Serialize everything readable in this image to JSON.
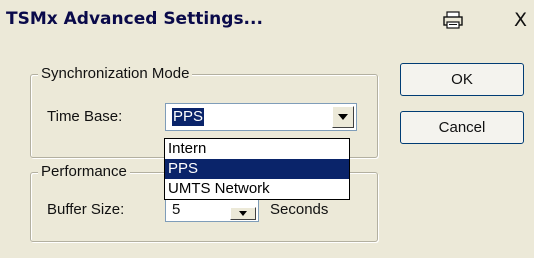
{
  "window": {
    "title": "TSMx Advanced Settings...",
    "close_glyph": "X"
  },
  "sync_group": {
    "legend": "Synchronization Mode",
    "time_base_label": "Time Base:",
    "time_base_value": "PPS",
    "options": [
      "Intern",
      "PPS",
      "UMTS Network"
    ],
    "selected_option": "PPS"
  },
  "perf_group": {
    "legend": "Performance",
    "buffer_label": "Buffer Size:",
    "buffer_value": "5",
    "unit": "Seconds"
  },
  "buttons": {
    "ok": "OK",
    "cancel": "Cancel"
  },
  "colors": {
    "selection": "#0a246a",
    "background": "#ece9d8"
  }
}
